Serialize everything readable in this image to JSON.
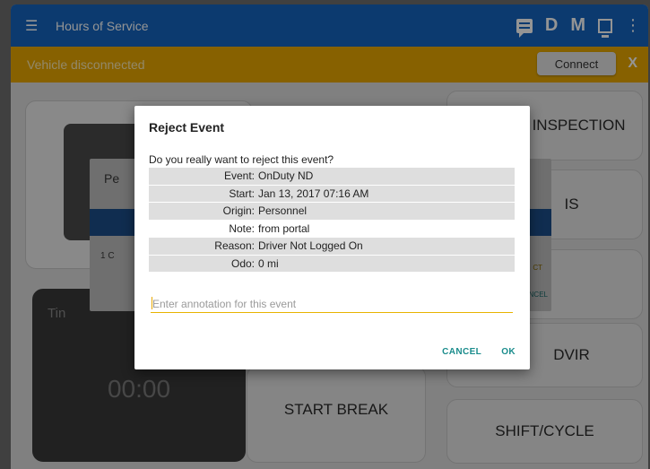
{
  "appbar": {
    "title": "Hours of Service",
    "icons": [
      "menu-icon",
      "message-icon",
      "d-icon",
      "m-icon",
      "dock-icon",
      "more-vert-icon"
    ],
    "d_label": "D",
    "m_label": "M"
  },
  "status": {
    "text": "Vehicle disconnected",
    "connect_label": "Connect",
    "close_label": "X",
    "color": "#e8a800"
  },
  "tiles": {
    "inspection": "E INSPECTION",
    "logs": "IS",
    "dvir": "DVIR",
    "shift_cycle": "SHIFT/CYCLE",
    "start_break": "START BREAK",
    "timer_label": "Tin",
    "timer_value": "00:00"
  },
  "under_dialog": {
    "title_fragment": "Pe",
    "row_fragment": "1  C",
    "r_fragment_1": "CT",
    "r_fragment_2": "NCEL"
  },
  "dialog": {
    "title": "Reject Event",
    "question": "Do you really want to reject this event?",
    "rows": [
      {
        "label": "Event:",
        "value": "OnDuty ND"
      },
      {
        "label": "Start:",
        "value": "Jan 13, 2017  07:16 AM"
      },
      {
        "label": "Origin:",
        "value": "Personnel"
      },
      {
        "label": "Note:",
        "value": "from portal"
      },
      {
        "label": "Reason:",
        "value": "Driver Not Logged On"
      },
      {
        "label": "Odo:",
        "value": "0 mi"
      }
    ],
    "annotation_placeholder": "Enter annotation for this event",
    "cancel_label": "CANCEL",
    "ok_label": "OK",
    "accent_color": "#1a8c8c"
  }
}
